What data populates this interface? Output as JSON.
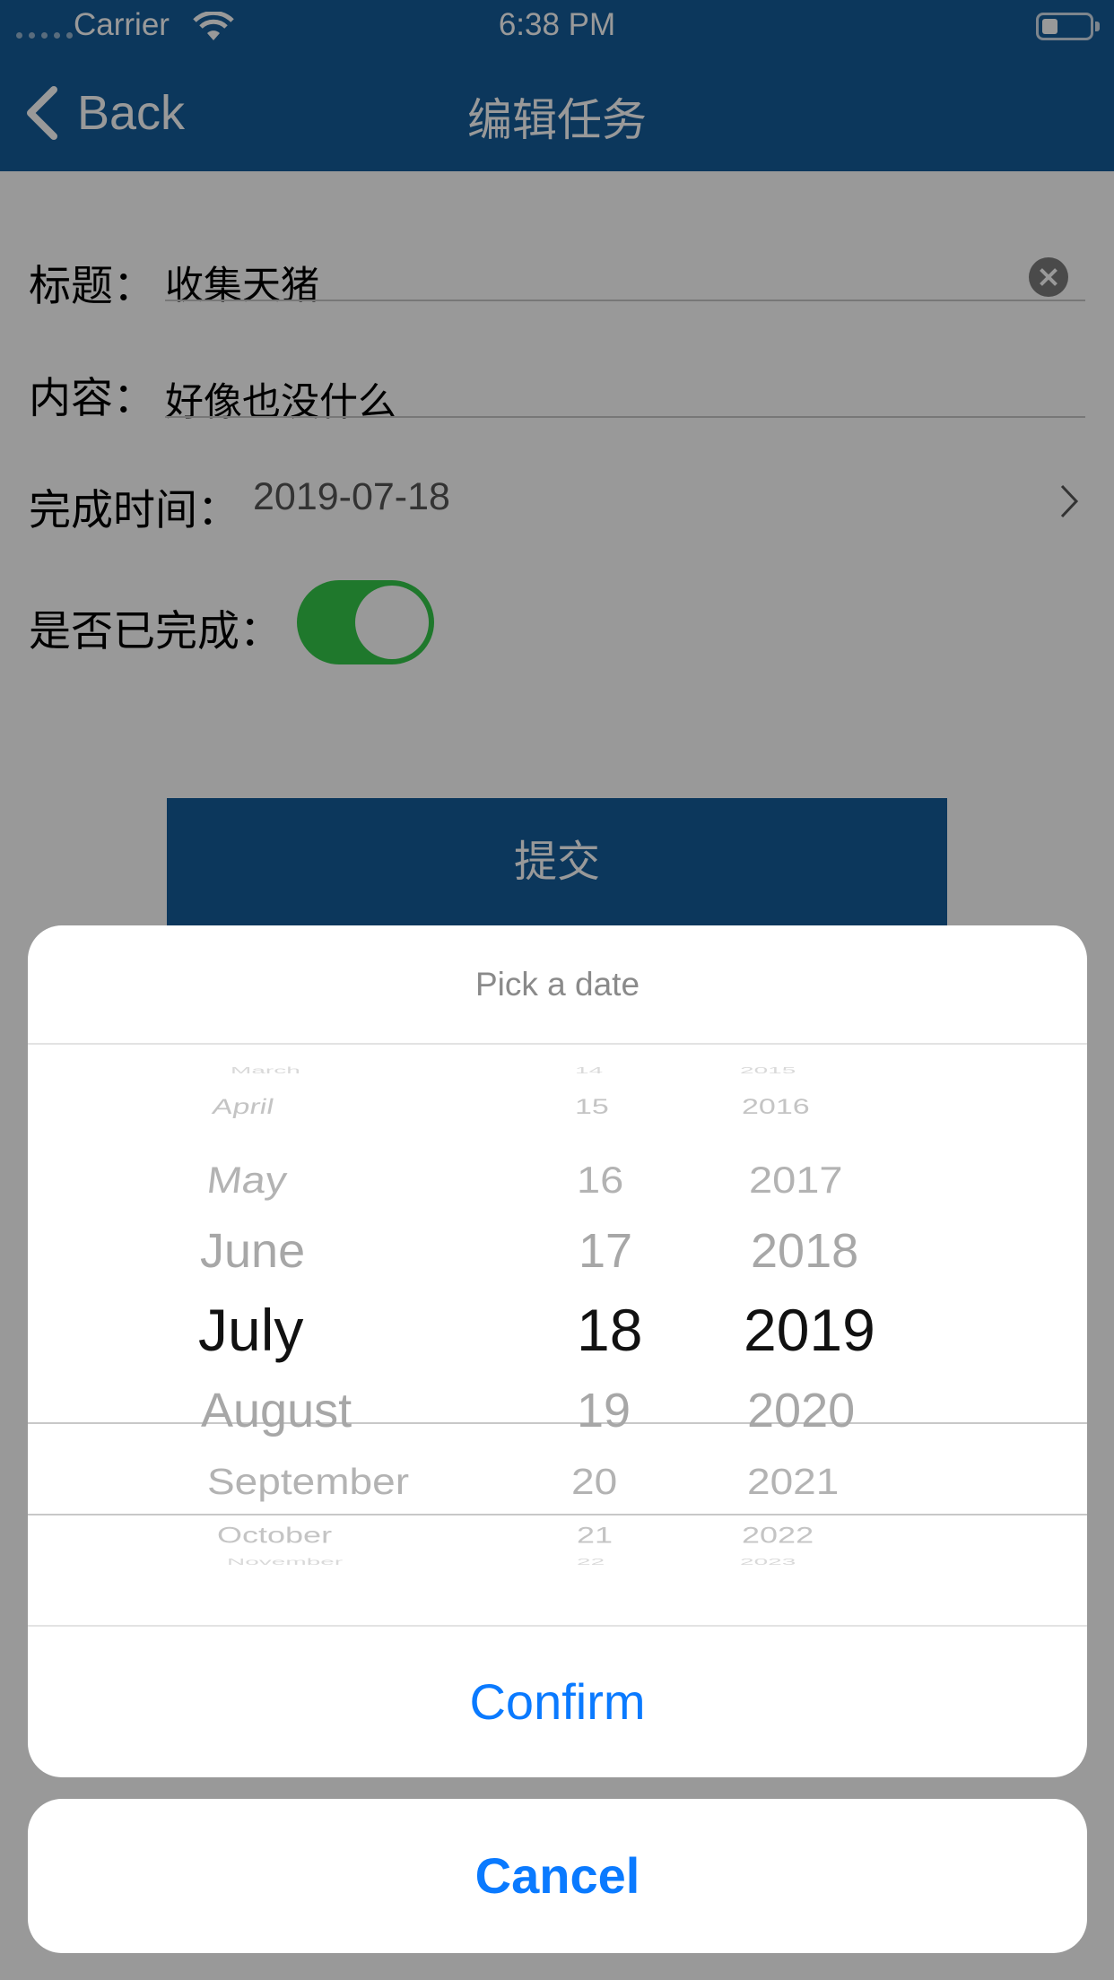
{
  "status_bar": {
    "carrier": "Carrier",
    "time": "6:38 PM"
  },
  "nav": {
    "back_label": "Back",
    "title": "编辑任务"
  },
  "form": {
    "title_label": "标题：",
    "title_value": "收集天猪",
    "content_label": "内容：",
    "content_value": "好像也没什么",
    "due_label": "完成时间：",
    "due_value": "2019-07-18",
    "done_label": "是否已完成：",
    "done_on": true,
    "submit_label": "提交"
  },
  "picker": {
    "title": "Pick a date",
    "months": [
      "March",
      "April",
      "May",
      "June",
      "July",
      "August",
      "September",
      "October",
      "November"
    ],
    "days": [
      "14",
      "15",
      "16",
      "17",
      "18",
      "19",
      "20",
      "21",
      "22"
    ],
    "years": [
      "2015",
      "2016",
      "2017",
      "2018",
      "2019",
      "2020",
      "2021",
      "2022",
      "2023"
    ],
    "selected_month": "July",
    "selected_day": "18",
    "selected_year": "2019",
    "confirm_label": "Confirm",
    "cancel_label": "Cancel"
  },
  "colors": {
    "nav": "#155c9a",
    "toggle_on": "#35c94a",
    "action": "#0a7aff"
  }
}
